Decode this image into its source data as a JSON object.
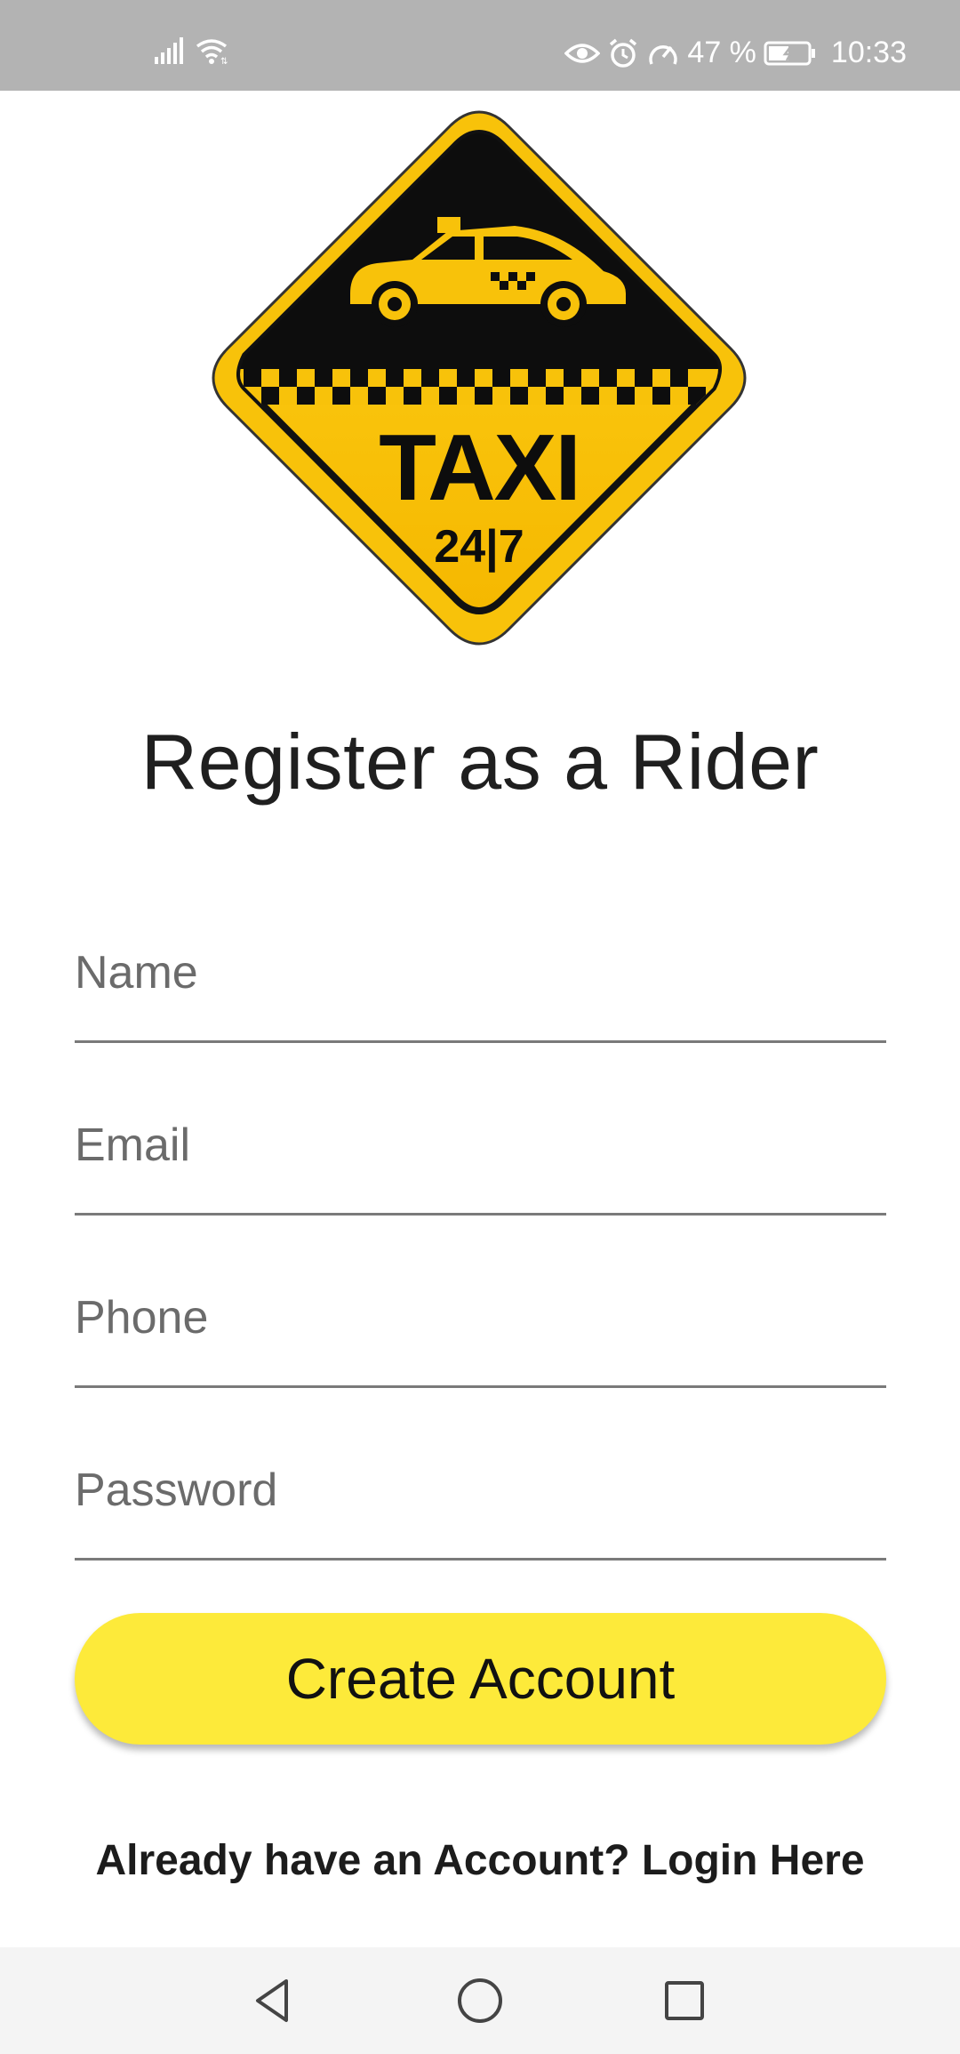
{
  "status_bar": {
    "battery": "47 %",
    "time": "10:33"
  },
  "logo": {
    "text": "TAXI",
    "subtext": "24|7",
    "colors": {
      "yellow": "#f9c80e",
      "black": "#0d0d0d"
    }
  },
  "page": {
    "title": "Register as a Rider"
  },
  "form": {
    "name_placeholder": "Name",
    "email_placeholder": "Email",
    "phone_placeholder": "Phone",
    "password_placeholder": "Password"
  },
  "actions": {
    "create_account_label": "Create Account",
    "login_link_label": "Already have an Account? Login Here"
  },
  "theme": {
    "accent": "#fdea3a",
    "status_bar_bg": "#b3b3b3"
  },
  "nav": {
    "icons": [
      "back-icon",
      "home-icon",
      "recents-icon"
    ]
  }
}
